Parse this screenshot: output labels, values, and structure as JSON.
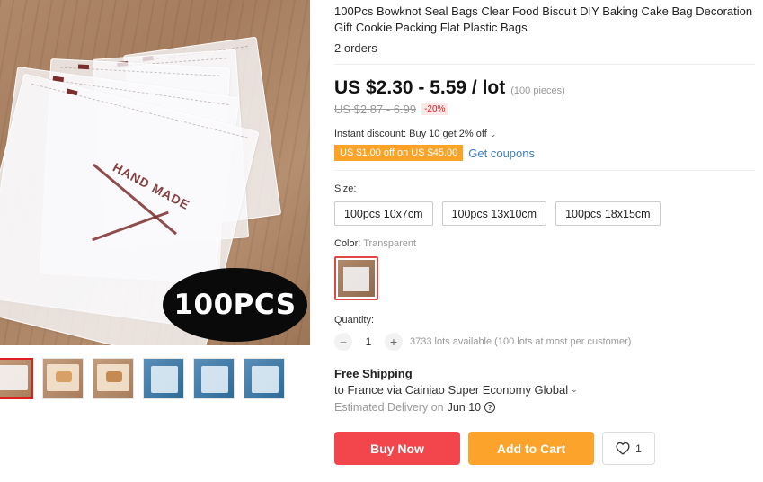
{
  "gallery": {
    "badge_text": "100PCS",
    "thumbnails": [
      "bags-white",
      "bags-food",
      "bags-cake",
      "bags-blue-1",
      "bags-blue-2",
      "bags-blue-3"
    ]
  },
  "product": {
    "title": "100Pcs Bowknot Seal Bags Clear Food Biscuit DIY Baking Cake Bag Decoration Gift Cookie Packing Flat Plastic Bags",
    "orders": "2 orders"
  },
  "price": {
    "current": "US $2.30 - 5.59 / lot",
    "pieces": "(100 pieces)",
    "original": "US $2.87 - 6.99",
    "discount": "-20%"
  },
  "promo": {
    "instant_discount": "Instant discount: Buy 10 get 2% off",
    "coupon": "US $1.00 off on US $45.00",
    "get_coupons": "Get coupons"
  },
  "size": {
    "label": "Size:",
    "options": [
      "100pcs 10x7cm",
      "100pcs 13x10cm",
      "100pcs 18x15cm"
    ]
  },
  "color": {
    "label": "Color:",
    "value": "Transparent"
  },
  "quantity": {
    "label": "Quantity:",
    "minus": "−",
    "value": "1",
    "plus": "+",
    "available": "3733 lots available (100 lots at most per customer)"
  },
  "shipping": {
    "title": "Free Shipping",
    "to": "to France via Cainiao Super Economy Global",
    "delivery_label": "Estimated Delivery on",
    "delivery_date": "Jun 10",
    "help": "?"
  },
  "actions": {
    "buy_now": "Buy Now",
    "add_to_cart": "Add to Cart",
    "wishlist_count": "1"
  },
  "colors": {
    "buy_now": "#f2454c",
    "add_to_cart": "#fba32a",
    "coupon": "#fba327",
    "link": "#3e7fbf",
    "discount": "#e02020"
  }
}
